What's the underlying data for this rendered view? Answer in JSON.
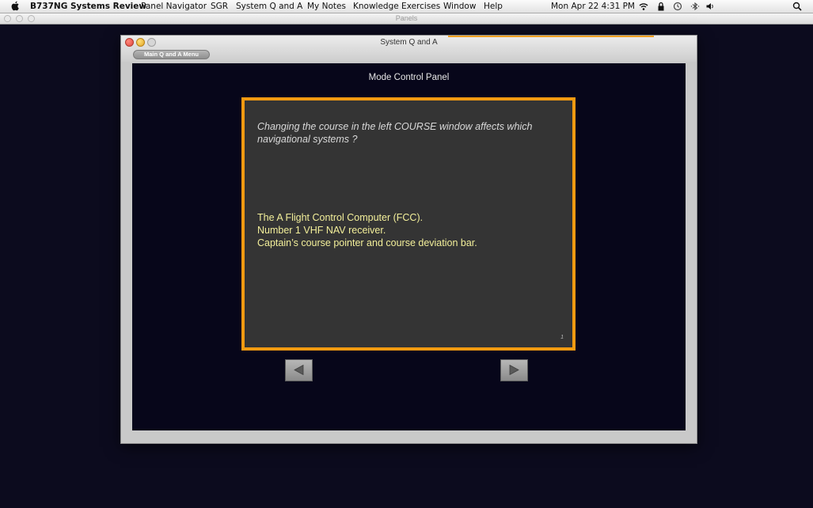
{
  "menubar": {
    "app_name": "B737NG Systems Review",
    "items": [
      "Panel Navigator",
      "SGR",
      "System Q and A",
      "My Notes",
      "Knowledge Exercises",
      "Window",
      "Help"
    ],
    "clock": "Mon Apr 22  4:31 PM",
    "status_icons": [
      "wifi-icon",
      "lock-icon",
      "time-machine-icon",
      "bluetooth-icon",
      "volume-icon",
      "spotlight-search-icon"
    ]
  },
  "panels_window": {
    "title": "Panels"
  },
  "qa_window": {
    "title": "System Q and A",
    "menu_button_label": "Main Q and A Menu",
    "section_title": "Mode Control Panel",
    "question": "Changing the course in the left COURSE window affects which navigational systems ?",
    "answers": [
      "The A Flight Control Computer (FCC).",
      "Number 1 VHF NAV receiver.",
      "Captain’s course pointer and course deviation bar."
    ],
    "page_number": "1",
    "prev_icon": "left-arrow-icon",
    "next_icon": "right-arrow-icon"
  },
  "colors": {
    "desktop": "#0c0b1e",
    "card_border": "#f29a11",
    "card_background": "#343434",
    "answer_text": "#f3ef9a",
    "question_text": "#d9d9d9"
  }
}
